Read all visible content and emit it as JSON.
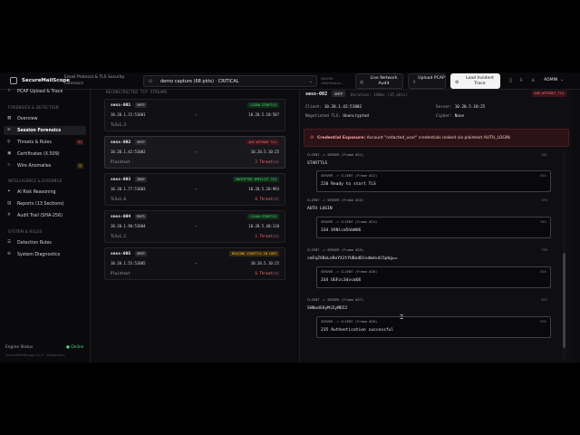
{
  "header": {
    "brand": "SecureMailScope",
    "separator": "/",
    "subtitle": "Email Protocol & TLS Security Forensics",
    "capture": "demo capture (68 pkts) · CRITICAL",
    "hash_label": "SHA256:",
    "hash_value": "c5be94cbcb...",
    "live_btn": "Live Network Audit",
    "upload_btn": "Upload PCAP",
    "load_btn": "Load Incident Trace",
    "user": "ADMIN"
  },
  "sidebar": {
    "top_item": "PCAP Upload & Trace",
    "sections": [
      {
        "label": "FORENSICS & DETECTION",
        "items": [
          {
            "label": "Overview",
            "icon": "grid-icon"
          },
          {
            "label": "Session Forensics",
            "icon": "stack-icon",
            "active": true
          },
          {
            "label": "Threats & Rules",
            "icon": "shield-icon",
            "badge": "31"
          },
          {
            "label": "Certificates (X.509)",
            "icon": "certificate-icon"
          },
          {
            "label": "Wire Anomalies",
            "icon": "pulse-icon",
            "badge": "2"
          }
        ]
      },
      {
        "label": "INTELLIGENCE & EVIDENCE",
        "items": [
          {
            "label": "AI Risk Reasoning",
            "icon": "sparkle-icon"
          },
          {
            "label": "Reports (13 Sections)",
            "icon": "document-icon"
          },
          {
            "label": "Audit Trail (SHA-256)",
            "icon": "hash-icon"
          }
        ]
      },
      {
        "label": "SYSTEM & RULES",
        "items": [
          {
            "label": "Detection Rules",
            "icon": "list-icon"
          },
          {
            "label": "System Diagnostics",
            "icon": "gear-icon"
          }
        ]
      }
    ],
    "engine_status": "Engine Status",
    "engine_online": "● Online",
    "engine_version": "SecureMailScope v1.0 · Production"
  },
  "streams": {
    "heading": "RECONSTRUCTED TCP STREAMS",
    "items": [
      {
        "id": "sess-001",
        "proto": "SMTP",
        "tag": "CLEAN STARTTLS",
        "tag_color": "green",
        "src": "10.20.1.15:51001",
        "dst": "10.20.5.10:587",
        "tls": "TLSv1.3",
        "threats": ""
      },
      {
        "id": "sess-002",
        "proto": "SMTP",
        "tag": "AUE WITHOUT TLS",
        "tag_color": "red",
        "src": "10.20.1.42:51002",
        "dst": "10.20.5.10:25",
        "tls": "Plaintext",
        "threats": "2 Threat(s)",
        "active": true
      },
      {
        "id": "sess-003",
        "proto": "IMAP",
        "tag": "ENCRYPTED IMPLICIT TLS",
        "tag_color": "green",
        "src": "10.20.1.77:51003",
        "dst": "10.20.5.20:993",
        "tls": "TLSv1.0",
        "threats": "6 Threat(s)"
      },
      {
        "id": "sess-004",
        "proto": "POP3",
        "tag": "CLEAN STARTTLS",
        "tag_color": "green",
        "src": "10.20.1.90:51004",
        "dst": "10.20.5.40:110",
        "tls": "TLSv1.2",
        "threats": "1 Threat(s)"
      },
      {
        "id": "sess-005",
        "proto": "SMTP",
        "tag": "MISSING STARTTLS IN CAPS",
        "tag_color": "amber",
        "src": "10.20.1.55:51005",
        "dst": "10.20.5.10:25",
        "tls": "Plaintext",
        "threats": "6 Threat(s)"
      }
    ]
  },
  "detail": {
    "id": "sess-002",
    "proto": "SMTP",
    "duration": "Duration: 140ms (15 pkts)",
    "tag": "AUE_WITHOUT_TLS",
    "client_label": "Client:",
    "client": "10.20.1.42:51002",
    "server_label": "Server:",
    "server": "10.20.5.10:25",
    "tls_label": "Negotiated TLS:",
    "tls": "Unencrypted",
    "cipher_label": "Cipher:",
    "cipher": "None",
    "alert_title": "Credential Exposure:",
    "alert_text": "Account \"redacted_user\" credentials leaked via plaintext AUTH_LOGIN.",
    "frames": [
      {
        "dir": "client",
        "hdr": "CLIENT -> SERVER (Frame #21)",
        "size": "581",
        "body": "STARTTLS"
      },
      {
        "dir": "server",
        "hdr": "SERVER -> CLIENT (Frame #22)",
        "size": "601",
        "body": "220 Ready to start TLS"
      },
      {
        "dir": "client",
        "hdr": "CLIENT -> SERVER (Frame #23)",
        "size": "575",
        "body": "AUTH LOGIN"
      },
      {
        "dir": "server",
        "hdr": "SERVER -> CLIENT (Frame #24)",
        "size": "581",
        "body": "334 VXNlcm5hbWU6"
      },
      {
        "dir": "client",
        "hdr": "CLIENT -> SERVER (Frame #25)",
        "size": "795",
        "body": "cmFqZXBoLnRoYXJtYUBadDJvdmdvdi5pbg=="
      },
      {
        "dir": "server",
        "hdr": "SERVER -> CLIENT (Frame #26)",
        "size": "605",
        "body": "334 UGFzc3dvcmQ6"
      },
      {
        "dir": "client",
        "hdr": "CLIENT -> SERVER (Frame #27)",
        "size": "622",
        "body": "SHNadGVyMiEyMDI2"
      },
      {
        "dir": "server",
        "hdr": "SERVER -> CLIENT (Frame #28)",
        "size": "635",
        "body": "235 Authentication successful"
      }
    ]
  },
  "colors": {
    "accent_green": "#4ade80",
    "accent_red": "#f87171",
    "accent_amber": "#fbbf24",
    "bg": "#0c0c0f"
  }
}
